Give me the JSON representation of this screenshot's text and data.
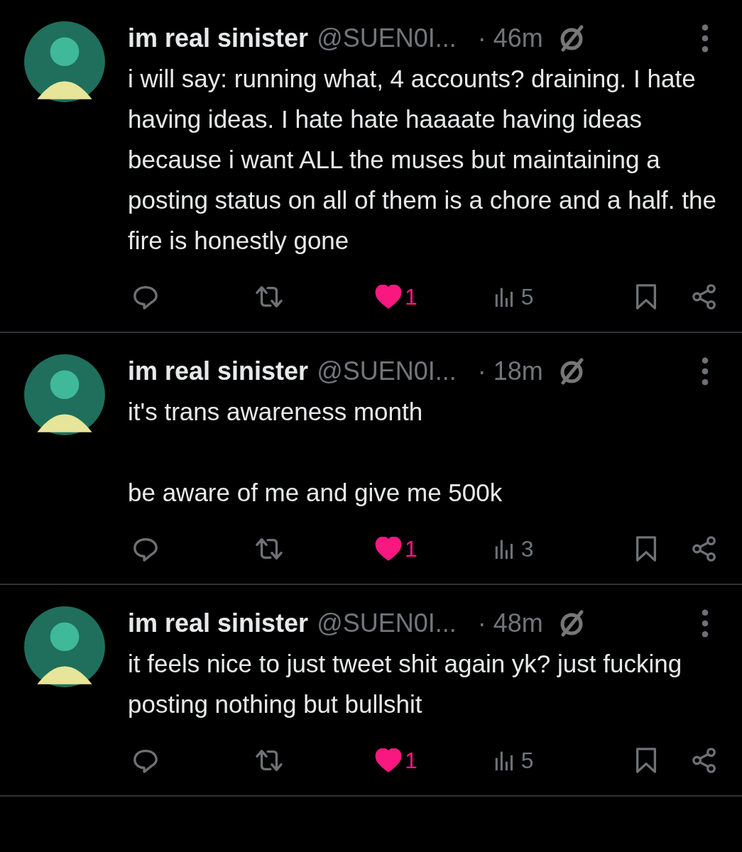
{
  "tweets": [
    {
      "name": "im real sinister",
      "handle": "@SUEN0I...",
      "time": "· 46m",
      "paragraphs": [
        "i will say: running what, 4 accounts? draining. I hate having ideas. I hate hate haaaate having ideas because i want ALL the muses but maintaining a posting status on all of them is a chore and a half. the fire is honestly gone"
      ],
      "likes": "1",
      "liked": true,
      "views": "5"
    },
    {
      "name": "im real sinister",
      "handle": "@SUEN0I...",
      "time": "· 18m",
      "paragraphs": [
        "it's trans awareness month",
        "be aware of me and give me 500k"
      ],
      "likes": "1",
      "liked": true,
      "views": "3"
    },
    {
      "name": "im real sinister",
      "handle": "@SUEN0I...",
      "time": "· 48m",
      "paragraphs": [
        "it feels nice to just tweet shit again yk? just fucking posting nothing but bullshit"
      ],
      "likes": "1",
      "liked": true,
      "views": "5"
    }
  ]
}
